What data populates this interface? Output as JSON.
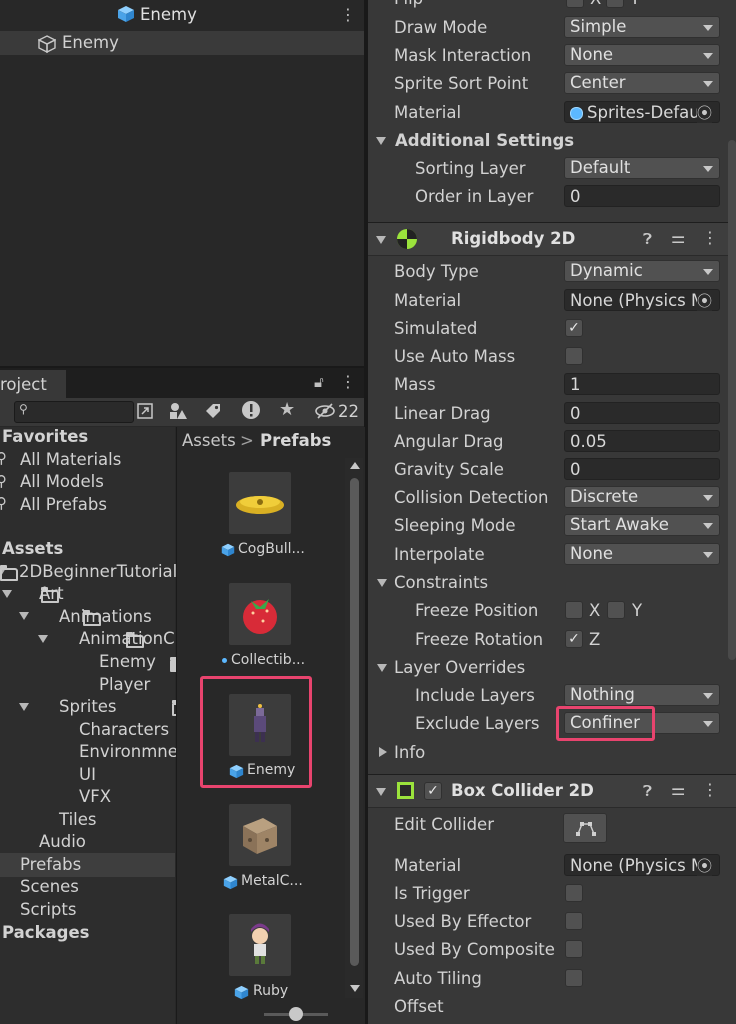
{
  "hierarchy": {
    "title": "Enemy",
    "items": [
      {
        "label": "Enemy"
      }
    ]
  },
  "project": {
    "tab_label": "roject",
    "toolbar": {
      "count": "22"
    },
    "breadcrumb": {
      "root": "Assets",
      "separator": ">",
      "current": "Prefabs"
    },
    "tree": {
      "favorites_label": "Favorites",
      "favorites": [
        "All Materials",
        "All Models",
        "All Prefabs"
      ],
      "assets_label": "Assets",
      "folders": [
        "2DBeginnerTutorial",
        "Art",
        "Animations",
        "AnimationCl",
        "Enemy",
        "Player",
        "Sprites",
        "Characters",
        "Environmne",
        "UI",
        "VFX",
        "Tiles",
        "Audio",
        "Prefabs",
        "Scenes",
        "Scripts"
      ],
      "packages_label": "Packages"
    },
    "assets": [
      "CogBull...",
      "Collectib...",
      "Enemy",
      "MetalC...",
      "Ruby"
    ]
  },
  "inspector": {
    "sprite_renderer": {
      "flip_label": "Flip",
      "flip_x": "X",
      "flip_y": "Y",
      "draw_mode_label": "Draw Mode",
      "draw_mode": "Simple",
      "mask_label": "Mask Interaction",
      "mask": "None",
      "sort_point_label": "Sprite Sort Point",
      "sort_point": "Center",
      "material_label": "Material",
      "material": "Sprites-Defau",
      "additional_label": "Additional Settings",
      "sorting_layer_label": "Sorting Layer",
      "sorting_layer": "Default",
      "order_label": "Order in Layer",
      "order": "0"
    },
    "rigidbody": {
      "title": "Rigidbody 2D",
      "body_type_label": "Body Type",
      "body_type": "Dynamic",
      "material_label": "Material",
      "material": "None (Physics M",
      "simulated_label": "Simulated",
      "use_auto_mass_label": "Use Auto Mass",
      "mass_label": "Mass",
      "mass": "1",
      "linear_drag_label": "Linear Drag",
      "linear_drag": "0",
      "angular_drag_label": "Angular Drag",
      "angular_drag": "0.05",
      "gravity_label": "Gravity Scale",
      "gravity": "0",
      "collision_label": "Collision Detection",
      "collision": "Discrete",
      "sleeping_label": "Sleeping Mode",
      "sleeping": "Start Awake",
      "interpolate_label": "Interpolate",
      "interpolate": "None",
      "constraints_label": "Constraints",
      "freeze_pos_label": "Freeze Position",
      "freeze_pos_x": "X",
      "freeze_pos_y": "Y",
      "freeze_rot_label": "Freeze Rotation",
      "freeze_rot_z": "Z",
      "layer_overrides_label": "Layer Overrides",
      "include_label": "Include Layers",
      "include": "Nothing",
      "exclude_label": "Exclude Layers",
      "exclude": "Confiner",
      "info_label": "Info"
    },
    "box_collider": {
      "title": "Box Collider 2D",
      "edit_label": "Edit Collider",
      "material_label": "Material",
      "material": "None (Physics M",
      "trigger_label": "Is Trigger",
      "effector_label": "Used By Effector",
      "composite_label": "Used By Composite",
      "tiling_label": "Auto Tiling",
      "offset_label": "Offset"
    }
  },
  "colors": {
    "highlight": "#e8446e",
    "prefab_blue": "#5cb8ff"
  }
}
